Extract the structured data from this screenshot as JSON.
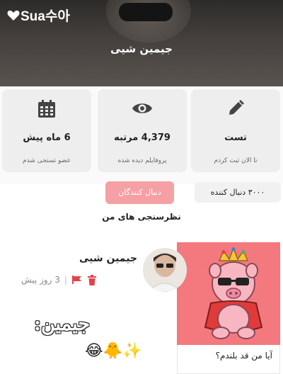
{
  "app": {
    "logo_text": "Sua수아"
  },
  "profile": {
    "name": "جیمین شیی"
  },
  "stats": [
    {
      "value": "تست",
      "caption": "تا الان ثبت کردم",
      "icon": "pencil-icon"
    },
    {
      "value": "4,379 مرتبه",
      "caption": "پروفایلم دیده شده",
      "icon": "eye-icon"
    },
    {
      "value": "6 ماه پیش",
      "caption": "عضو تستجی شدم",
      "icon": "calendar-icon"
    }
  ],
  "followers": {
    "count_label": "۳۰۰۰ دنبال کننده",
    "button_label": "دنبال کنندگان"
  },
  "section_title": "نظرسنجی های من",
  "post": {
    "author": "جیمین شیی",
    "time": "3 روز پیش",
    "text": "جیمین:",
    "emoji": "😂🐥✨",
    "question": "آیا من قد بلندم؟"
  },
  "colors": {
    "accent": "#f5a0a4",
    "post_background": "#f3797e",
    "flag": "#e2444c"
  }
}
